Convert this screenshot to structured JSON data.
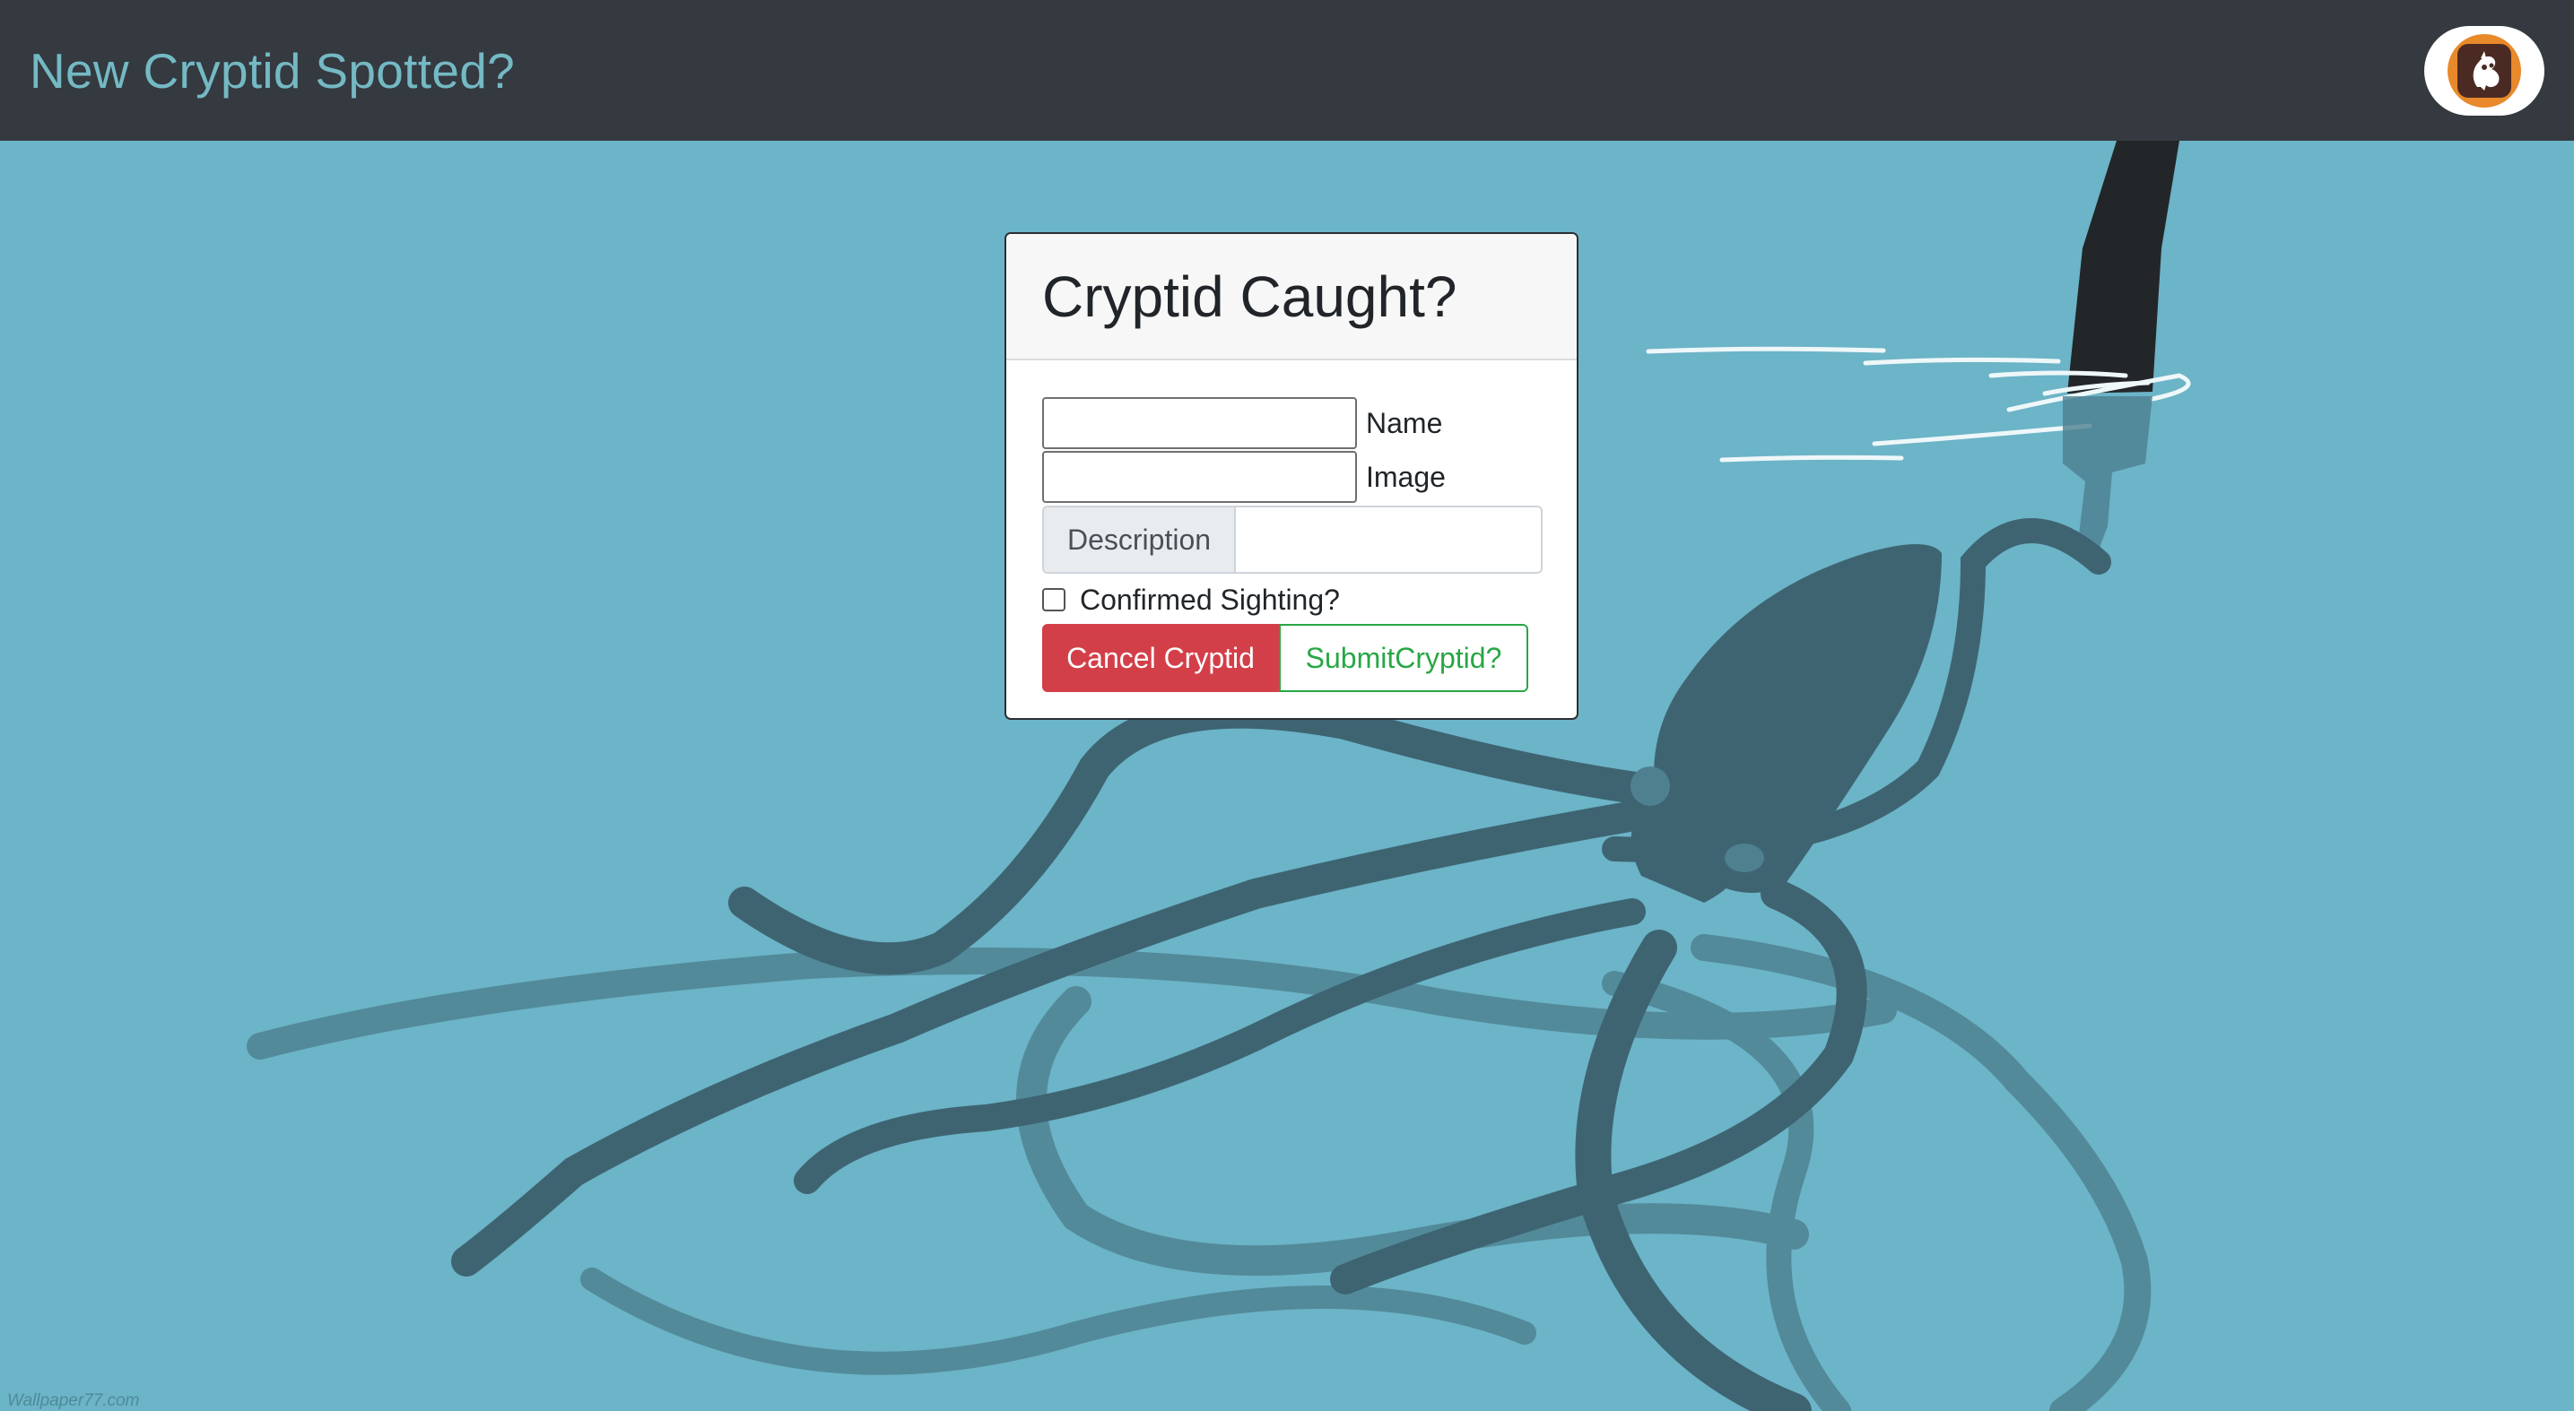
{
  "navbar": {
    "brand": "New Cryptid Spotted?",
    "logo_icon": "cryptid-logo-icon"
  },
  "form": {
    "title": "Cryptid Caught?",
    "name_label": "Name",
    "image_label": "Image",
    "description_label": "Description",
    "name_value": "",
    "image_value": "",
    "description_value": "",
    "confirmed_label": "Confirmed Sighting?",
    "confirmed_checked": false,
    "cancel_label": "Cancel Cryptid",
    "submit_label": "SubmitCryptid?"
  },
  "background": {
    "watermark": "Wallpaper77.com"
  },
  "colors": {
    "navbar": "#343a40",
    "brand": "#74b9c4",
    "water": "#6cb4c7",
    "cancel": "#d33f49",
    "submit": "#28a745"
  }
}
